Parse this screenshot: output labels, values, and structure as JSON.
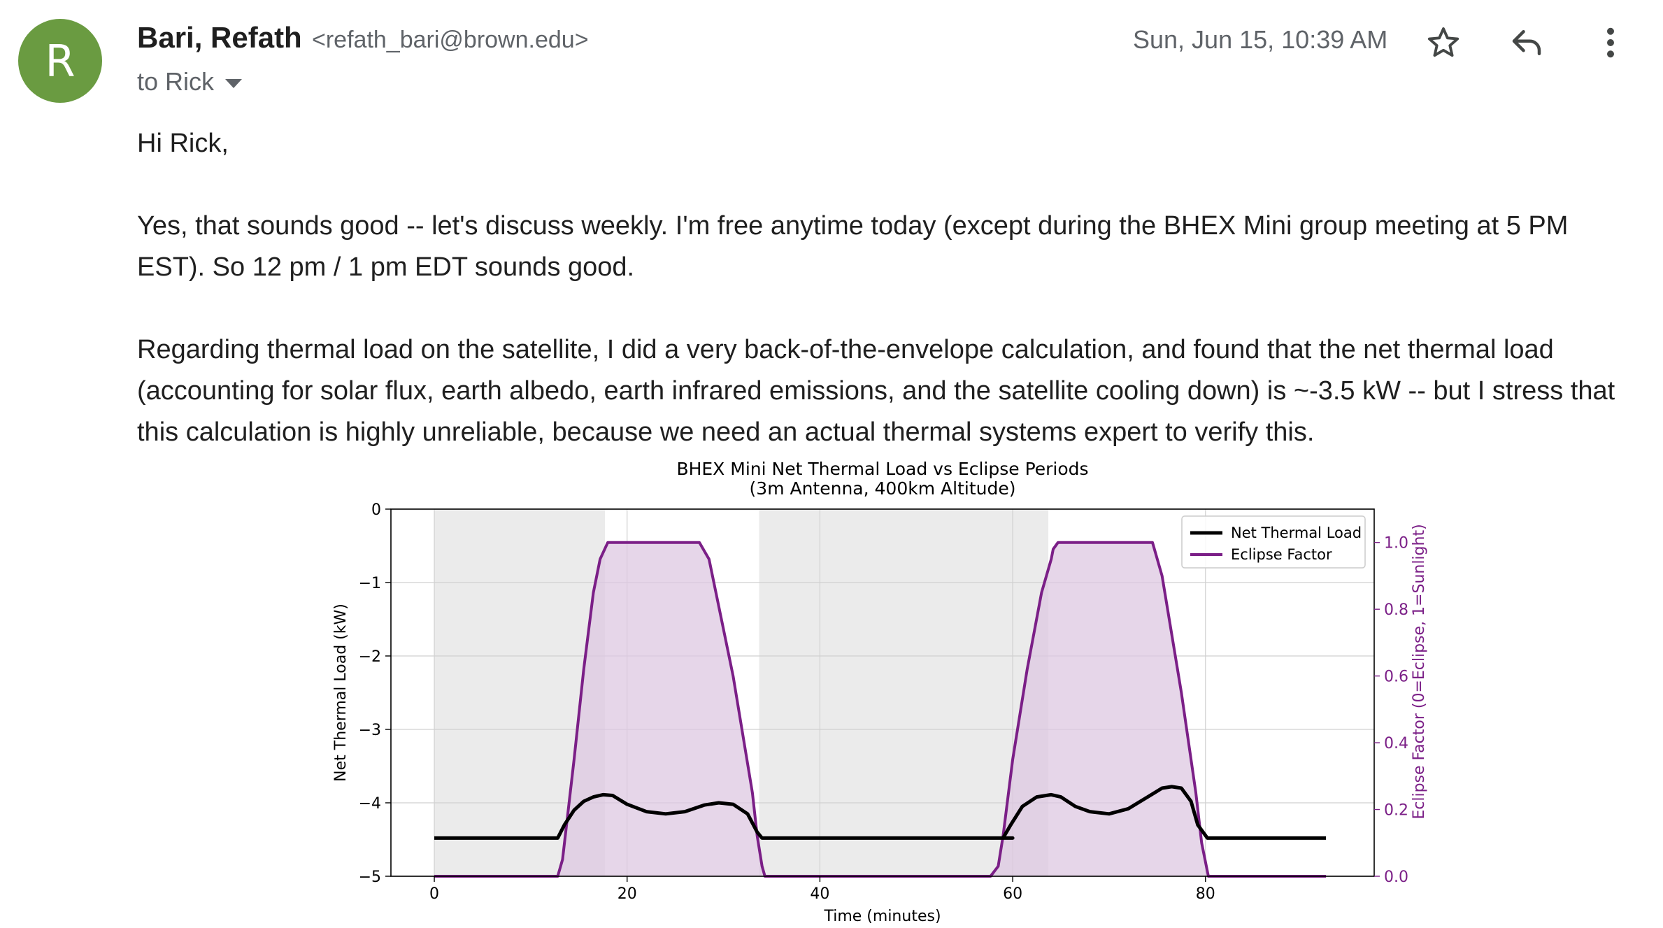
{
  "sender": {
    "initial": "R",
    "name": "Bari, Refath",
    "email": "<refath_bari@brown.edu>",
    "avatar_color": "#6a9b41"
  },
  "recipient": {
    "label": "to Rick"
  },
  "date": "Sun, Jun 15, 10:39 AM",
  "icons": {
    "star": "star-icon",
    "reply": "reply-icon",
    "more": "more-vert-icon"
  },
  "body": {
    "greeting": "Hi Rick,",
    "paragraph1": "Yes, that sounds good -- let's discuss weekly. I'm free anytime today (except during the BHEX Mini group meeting at 5 PM EST). So 12 pm / 1 pm EDT sounds good.",
    "paragraph2": "Regarding thermal load on the satellite, I did a very back-of-the-envelope calculation, and found that the net thermal load (accounting for solar flux, earth albedo, earth infrared emissions, and the satellite cooling down) is ~-3.5 kW -- but I stress that this calculation is highly unreliable, because we need an actual thermal systems expert to verify this."
  },
  "chart_data": {
    "type": "line",
    "title": "BHEX Mini Net Thermal Load vs Eclipse Periods",
    "subtitle": "(3m Antenna, 400km Altitude)",
    "xlabel": "Time (minutes)",
    "ylabel": "Net Thermal Load (kW)",
    "y2label": "Eclipse Factor (0=Eclipse, 1=Sunlight)",
    "xlim": [
      -4.5,
      97.5
    ],
    "ylim": [
      -5,
      0
    ],
    "y2lim": [
      0,
      1.1
    ],
    "xticks": [
      0,
      20,
      40,
      60,
      80
    ],
    "yticks": [
      0,
      -1,
      -2,
      -3,
      -4,
      -5
    ],
    "y2ticks": [
      0.0,
      0.2,
      0.4,
      0.6,
      0.8,
      1.0
    ],
    "grid": true,
    "legend_position": "top-right",
    "colors": {
      "load": "#000000",
      "eclipse": "#7b1f87",
      "eclipse_fill": "#ddc8e1",
      "shade": "#ebebeb"
    },
    "shaded_regions": [
      [
        0,
        17.7
      ],
      [
        33.7,
        63.7
      ]
    ],
    "series": [
      {
        "name": "Net Thermal Load",
        "axis": "left",
        "x": [
          0,
          12.8,
          13.5,
          14.5,
          15.5,
          16.5,
          17.5,
          18.5,
          20,
          22,
          24,
          26,
          28,
          29.5,
          31,
          32.5,
          33.5,
          34,
          60,
          59,
          59.8,
          61,
          62.5,
          64,
          65,
          66.5,
          68,
          70,
          72,
          74,
          75.5,
          76.5,
          77.5,
          78.5,
          79.2,
          80.2,
          82,
          92.5
        ],
        "y": [
          -4.48,
          -4.48,
          -4.3,
          -4.1,
          -3.98,
          -3.92,
          -3.89,
          -3.9,
          -4.02,
          -4.12,
          -4.15,
          -4.12,
          -4.03,
          -4.0,
          -4.02,
          -4.15,
          -4.4,
          -4.48,
          -4.48,
          -4.48,
          -4.3,
          -4.05,
          -3.92,
          -3.89,
          -3.92,
          -4.05,
          -4.12,
          -4.15,
          -4.08,
          -3.92,
          -3.8,
          -3.78,
          -3.8,
          -3.98,
          -4.3,
          -4.48,
          -4.48,
          -4.48
        ]
      },
      {
        "name": "Eclipse Factor",
        "axis": "right",
        "x": [
          0,
          12.8,
          13.3,
          14.5,
          15.5,
          16.5,
          17.2,
          18,
          18.3,
          27.5,
          28.5,
          31,
          33,
          33.5,
          34,
          34.3,
          57.7,
          58.5,
          59,
          60,
          61.5,
          63,
          64,
          64.2,
          64.7,
          65,
          74.5,
          75.5,
          77.5,
          79,
          79.6,
          80.3,
          92.5
        ],
        "y": [
          0,
          0,
          0.05,
          0.35,
          0.62,
          0.85,
          0.95,
          1.0,
          1.0,
          1.0,
          0.95,
          0.6,
          0.25,
          0.12,
          0.03,
          0,
          0,
          0.03,
          0.12,
          0.35,
          0.62,
          0.85,
          0.95,
          0.98,
          1.0,
          1.0,
          1.0,
          0.9,
          0.55,
          0.25,
          0.1,
          0,
          0
        ]
      }
    ]
  }
}
